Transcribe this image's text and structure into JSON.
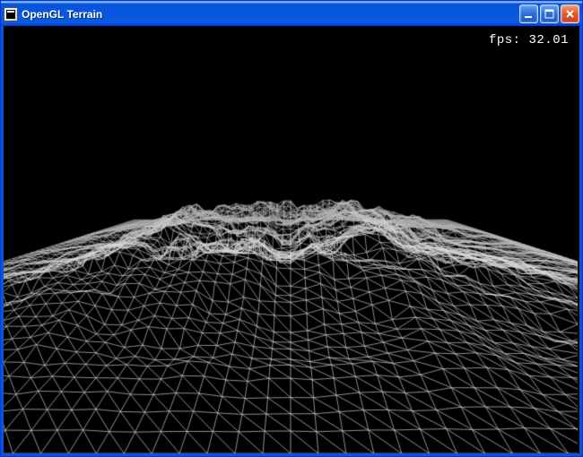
{
  "window": {
    "title": "OpenGL Terrain",
    "icon": "console-icon"
  },
  "controls": {
    "minimize": "minimize",
    "maximize": "maximize",
    "close": "close"
  },
  "viewport": {
    "fps_label": "fps:",
    "fps_value": "32.01",
    "background_color": "#000000",
    "wireframe_color": "#dddddd"
  }
}
